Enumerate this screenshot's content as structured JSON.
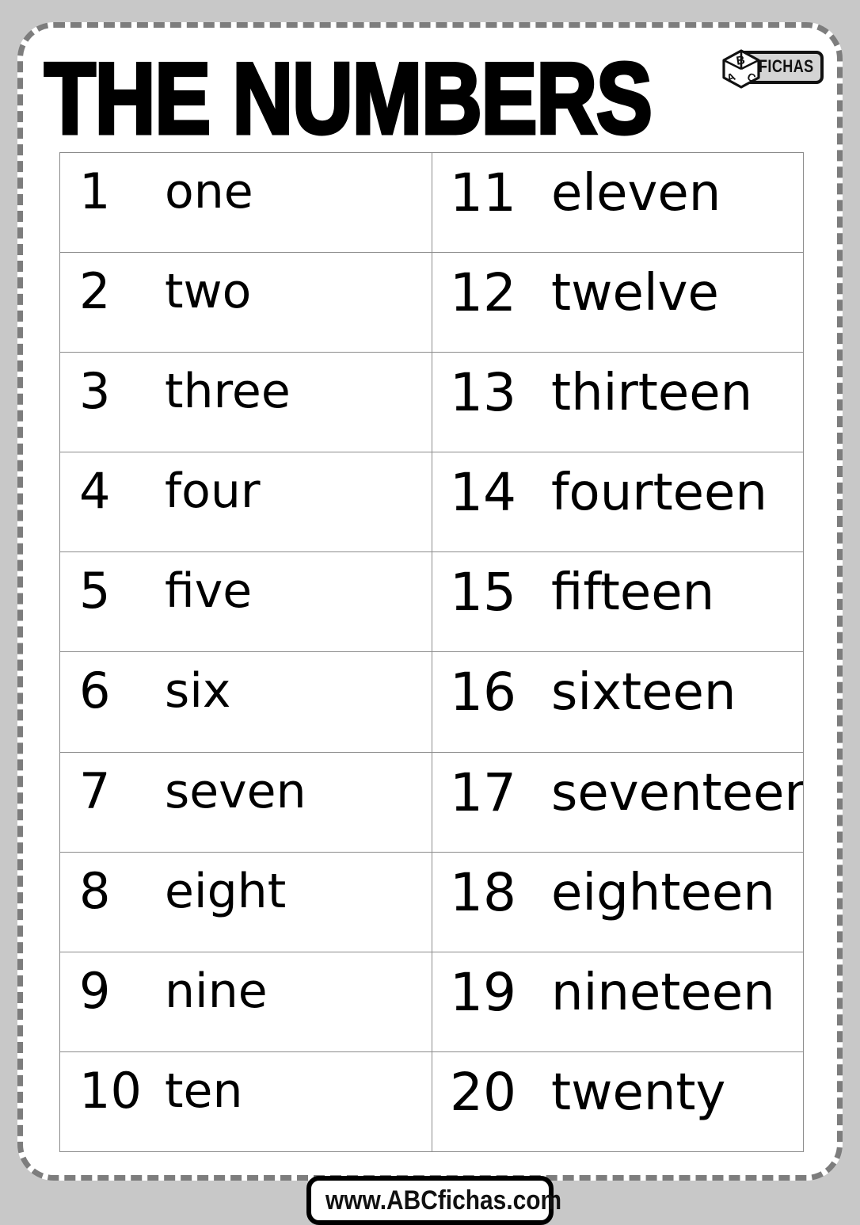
{
  "page": {
    "title": "THE NUMBERS",
    "background_color": "#c8c8c8",
    "page_color": "#ffffff",
    "border_color": "#7d7d7d",
    "text_color": "#000000",
    "table_border_color": "#8c8c8c"
  },
  "logo": {
    "brand": "FICHAS",
    "cube_letters": {
      "top": "B",
      "left": "A",
      "right": "C"
    },
    "plate_color": "#d4d4d4"
  },
  "table": {
    "rows": [
      {
        "left": {
          "numeral": "1",
          "word": "one"
        },
        "right": {
          "numeral": "11",
          "word": "eleven"
        }
      },
      {
        "left": {
          "numeral": "2",
          "word": "two"
        },
        "right": {
          "numeral": "12",
          "word": "twelve"
        }
      },
      {
        "left": {
          "numeral": "3",
          "word": "three"
        },
        "right": {
          "numeral": "13",
          "word": "thirteen"
        }
      },
      {
        "left": {
          "numeral": "4",
          "word": "four"
        },
        "right": {
          "numeral": "14",
          "word": "fourteen"
        }
      },
      {
        "left": {
          "numeral": "5",
          "word": "five"
        },
        "right": {
          "numeral": "15",
          "word": "fifteen"
        }
      },
      {
        "left": {
          "numeral": "6",
          "word": "six"
        },
        "right": {
          "numeral": "16",
          "word": "sixteen"
        }
      },
      {
        "left": {
          "numeral": "7",
          "word": "seven"
        },
        "right": {
          "numeral": "17",
          "word": "seventeen"
        }
      },
      {
        "left": {
          "numeral": "8",
          "word": "eight"
        },
        "right": {
          "numeral": "18",
          "word": "eighteen"
        }
      },
      {
        "left": {
          "numeral": "9",
          "word": "nine"
        },
        "right": {
          "numeral": "19",
          "word": "nineteen"
        }
      },
      {
        "left": {
          "numeral": "10",
          "word": "ten"
        },
        "right": {
          "numeral": "20",
          "word": "twenty"
        }
      }
    ]
  },
  "footer": {
    "url": "www.ABCfichas.com"
  }
}
